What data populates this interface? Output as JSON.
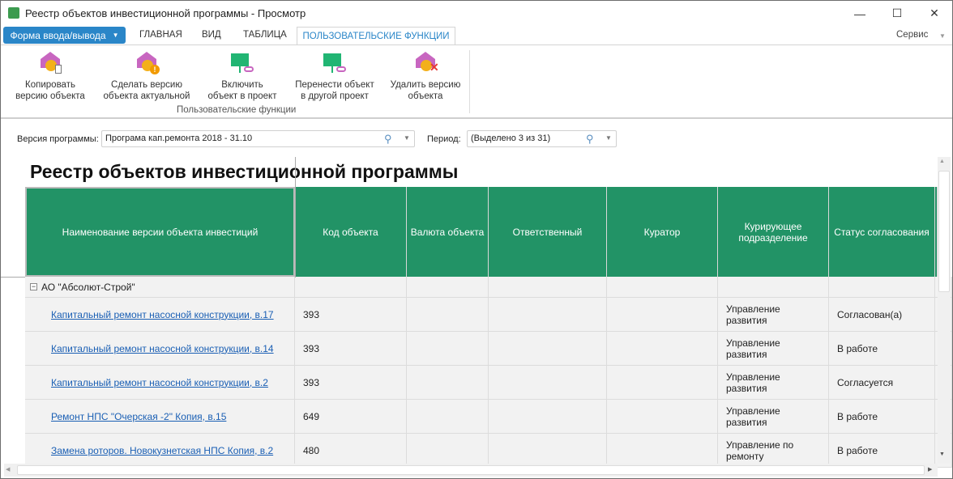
{
  "window": {
    "title": "Реестр объектов инвестиционной программы - Просмотр",
    "minimize": "—",
    "maximize": "☐",
    "close": "✕"
  },
  "ribbon_tabs": {
    "form": "Форма ввода/вывода",
    "main": "ГЛАВНАЯ",
    "view": "ВИД",
    "table": "ТАБЛИЦА",
    "custom": "ПОЛЬЗОВАТЕЛЬСКИЕ ФУНКЦИИ",
    "service": "Сервис"
  },
  "ribbon": {
    "group_label": "Пользовательские функции",
    "buttons": [
      {
        "l1": "Копировать",
        "l2": "версию объекта"
      },
      {
        "l1": "Сделать версию",
        "l2": "объекта актуальной"
      },
      {
        "l1": "Включить",
        "l2": "объект в проект"
      },
      {
        "l1": "Перенести объект",
        "l2": "в  другой проект"
      },
      {
        "l1": "Удалить версию",
        "l2": "объекта"
      }
    ]
  },
  "filters": {
    "version_label": "Версия программы:",
    "version_value": "Програма кап.ремонта 2018 - 31.10",
    "period_label": "Период:",
    "period_value": "(Выделено 3 из 31)"
  },
  "report": {
    "title": "Реестр объектов инвестиционной программы",
    "columns": [
      "Наименование версии объекта инвестиций",
      "Код объекта",
      "Валюта объекта",
      "Ответственный",
      "Куратор",
      "Курирующее подразделение",
      "Статус согласования"
    ],
    "group": "АО \"Абсолют-Строй\"",
    "rows": [
      {
        "name": "Капитальный ремонт насосной конструкции, в.17",
        "code": "393",
        "dept": "Управление развития",
        "status": "Согласован(а)"
      },
      {
        "name": "Капитальный ремонт насосной конструкции, в.14",
        "code": "393",
        "dept": "Управление развития",
        "status": "В работе"
      },
      {
        "name": "Капитальный ремонт насосной конструкции, в.2",
        "code": "393",
        "dept": "Управление развития",
        "status": "Согласуется"
      },
      {
        "name": "Ремонт НПС \"Очерская -2\" Копия, в.15",
        "code": "649",
        "dept": "Управление развития",
        "status": "В работе"
      },
      {
        "name": "Замена роторов. Новокузнетская НПС Копия, в.2",
        "code": "480",
        "dept": "Управление по ремонту",
        "status": "В работе"
      }
    ]
  },
  "colors": {
    "header": "#229366",
    "accent": "#2a86c8",
    "link": "#1a5fb4"
  }
}
